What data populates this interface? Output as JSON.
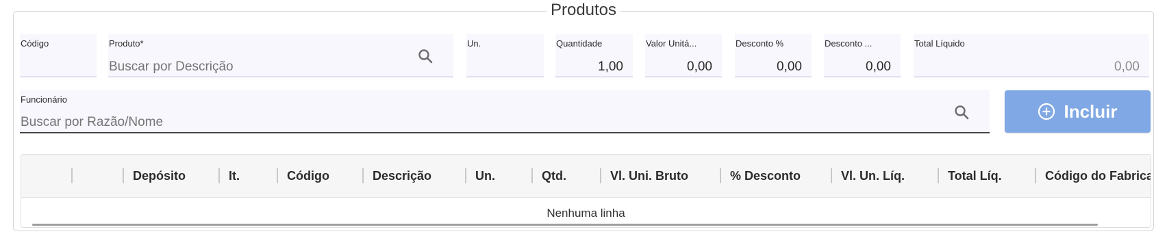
{
  "section": {
    "title": "Produtos"
  },
  "fields": {
    "codigo": {
      "label": "Código",
      "value": ""
    },
    "produto": {
      "label": "Produto*",
      "placeholder": "Buscar por Descrição"
    },
    "un": {
      "label": "Un.",
      "value": ""
    },
    "quantidade": {
      "label": "Quantidade",
      "value": "1,00"
    },
    "valor_unitario": {
      "label": "Valor Unitá...",
      "value": "0,00"
    },
    "desconto_pct": {
      "label": "Desconto %",
      "value": "0,00"
    },
    "desconto_valor": {
      "label": "Desconto ...",
      "value": "0,00"
    },
    "total_liquido": {
      "label": "Total Líquido",
      "value": "0,00"
    },
    "funcionario": {
      "label": "Funcionário",
      "placeholder": "Buscar por Razão/Nome"
    }
  },
  "actions": {
    "incluir_label": "Incluir"
  },
  "grid": {
    "columns": [
      "",
      "",
      "Depósito",
      "It.",
      "Código",
      "Descrição",
      "Un.",
      "Qtd.",
      "Vl. Uni. Bruto",
      "% Desconto",
      "Vl. Un. Líq.",
      "Total Líq.",
      "Código do Fabricant"
    ],
    "empty_text": "Nenhuma linha"
  },
  "icons": {
    "search": "search-icon",
    "add": "plus-circle-icon"
  },
  "colors": {
    "primary_button": "#80a8e4",
    "field_bg": "#f7f7fd"
  }
}
